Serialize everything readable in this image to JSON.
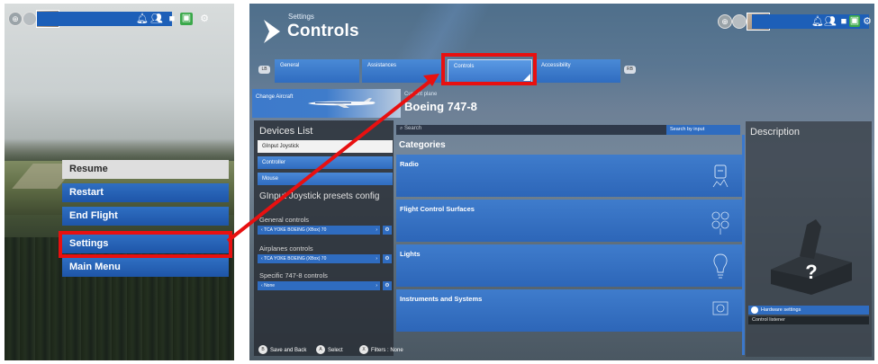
{
  "left": {
    "menu": [
      {
        "label": "Resume"
      },
      {
        "label": "Restart"
      },
      {
        "label": "End Flight"
      },
      {
        "label": "Settings"
      },
      {
        "label": "Main Menu"
      }
    ]
  },
  "right": {
    "header": {
      "small": "Settings",
      "title": "Controls"
    },
    "tabs": [
      {
        "label": "General"
      },
      {
        "label": "Assistances"
      },
      {
        "label": "Controls"
      },
      {
        "label": "Accessibility"
      }
    ],
    "tab_badges": {
      "left": "LB",
      "right": "RB"
    },
    "aircraft": {
      "button": "Change Aircraft",
      "current_label": "Current plane",
      "current": "Boeing 747-8"
    },
    "devices": {
      "title": "Devices List",
      "items": [
        {
          "label": "GInput Joystick"
        },
        {
          "label": "Controller"
        },
        {
          "label": "Mouse"
        }
      ],
      "presets_title": "GInput Joystick presets config",
      "groups": [
        {
          "label": "General controls",
          "value": "TCA YOKE BOEING (XBox) 70"
        },
        {
          "label": "Airplanes controls",
          "value": "TCA YOKE BOEING (XBox) 70"
        },
        {
          "label": "Specific 747-8 controls",
          "value": "None"
        }
      ]
    },
    "search": {
      "placeholder": "Search",
      "button": "Search by input"
    },
    "categories": {
      "title": "Categories",
      "items": [
        {
          "label": "Radio"
        },
        {
          "label": "Flight Control Surfaces"
        },
        {
          "label": "Lights"
        },
        {
          "label": "Instruments and Systems"
        }
      ]
    },
    "description": {
      "title": "Description",
      "unknown_mark": "?",
      "hardware": "Hardware settings",
      "listener": "Control listener"
    },
    "footer": [
      {
        "glyph": "B",
        "label": "Save and Back"
      },
      {
        "glyph": "A",
        "label": "Select"
      },
      {
        "glyph": "X",
        "label": "Filters : None"
      }
    ]
  },
  "colors": {
    "highlight": "#e81010",
    "accent": "#2f6cc0",
    "notification_green": "#3aa84a"
  }
}
